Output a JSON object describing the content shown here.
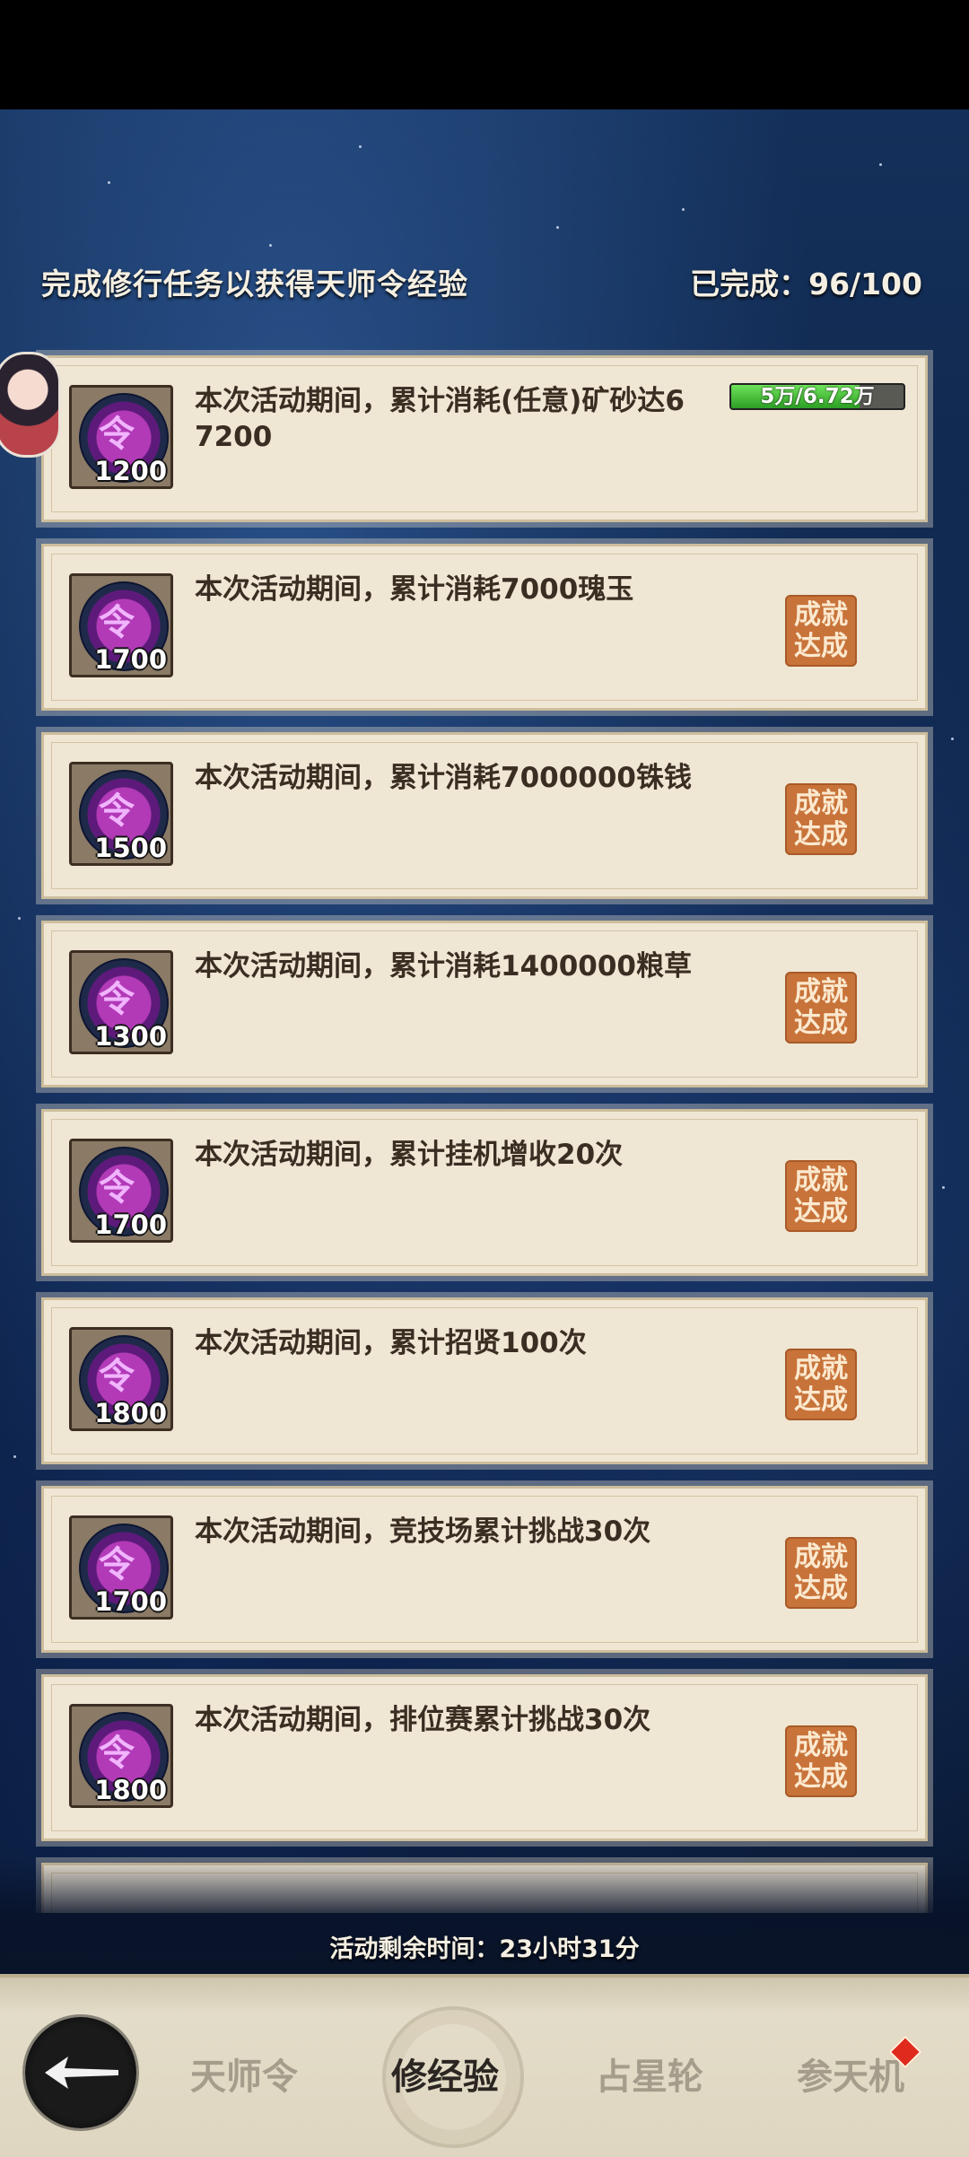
{
  "header": {
    "title": "完成修行任务以获得天师令经验",
    "progress": "已完成：96/100"
  },
  "tasks": [
    {
      "reward": "1200",
      "text": "本次活动期间，累计消耗(任意)矿砂达67200",
      "progress_label": "5万/6.72万",
      "progress_fraction": 0.744
    },
    {
      "reward": "1700",
      "text": "本次活动期间，累计消耗7000瑰玉",
      "status": "成就达成"
    },
    {
      "reward": "1500",
      "text": "本次活动期间，累计消耗7000000铢钱",
      "status": "成就达成"
    },
    {
      "reward": "1300",
      "text": "本次活动期间，累计消耗1400000粮草",
      "status": "成就达成"
    },
    {
      "reward": "1700",
      "text": "本次活动期间，累计挂机增收20次",
      "status": "成就达成"
    },
    {
      "reward": "1800",
      "text": "本次活动期间，累计招贤100次",
      "status": "成就达成"
    },
    {
      "reward": "1700",
      "text": "本次活动期间，竞技场累计挑战30次",
      "status": "成就达成"
    },
    {
      "reward": "1800",
      "text": "本次活动期间，排位赛累计挑战30次",
      "status": "成就达成"
    }
  ],
  "timer": "活动剩余时间：23小时31分",
  "nav": {
    "tabs": [
      "天师令",
      "修经验",
      "占星轮",
      "参天机"
    ],
    "active": "修经验"
  }
}
